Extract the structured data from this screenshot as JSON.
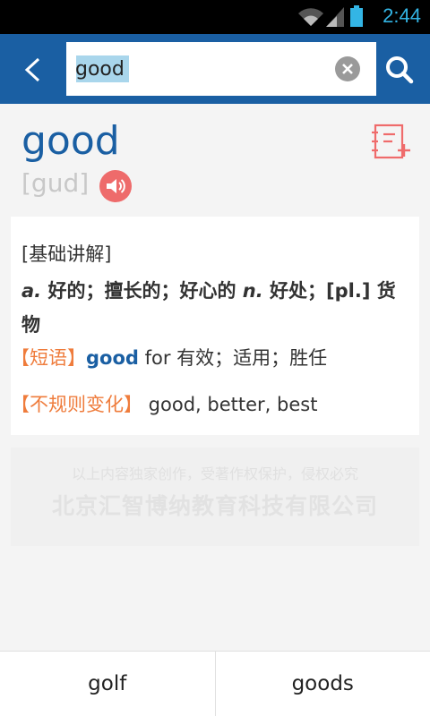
{
  "status_bar": {
    "time": "2:44",
    "icons": [
      "wifi-icon",
      "signal-icon",
      "battery-icon"
    ],
    "accent": "#33b5e5"
  },
  "app_bar": {
    "color": "#1a5fa3",
    "back_icon": "back-arrow-icon",
    "search_value": "good",
    "clear_icon": "clear-icon",
    "search_icon": "search-icon"
  },
  "entry": {
    "word": "good",
    "phonetic": "[gud]",
    "speaker_icon": "speaker-icon",
    "wordbook_icon": "add-wordbook-icon",
    "basic_label": "[基础讲解]",
    "definition": {
      "pos1": "a.",
      "meaning1": " 好的；擅长的；好心的 ",
      "pos2": "n.",
      "meaning2": " 好处；[pl.] 货物"
    },
    "phrase": {
      "tag": "【短语】",
      "word": "good",
      "rest": " for 有效；适用；胜任"
    },
    "irregular": {
      "tag": "【不规则变化】",
      "forms": " good, better, best"
    }
  },
  "copyright": {
    "line1": "以上内容独家创作，受著作权保护，侵权必究",
    "line2": "北京汇智博纳教育科技有限公司"
  },
  "suggestions": [
    "golf",
    "goods"
  ]
}
